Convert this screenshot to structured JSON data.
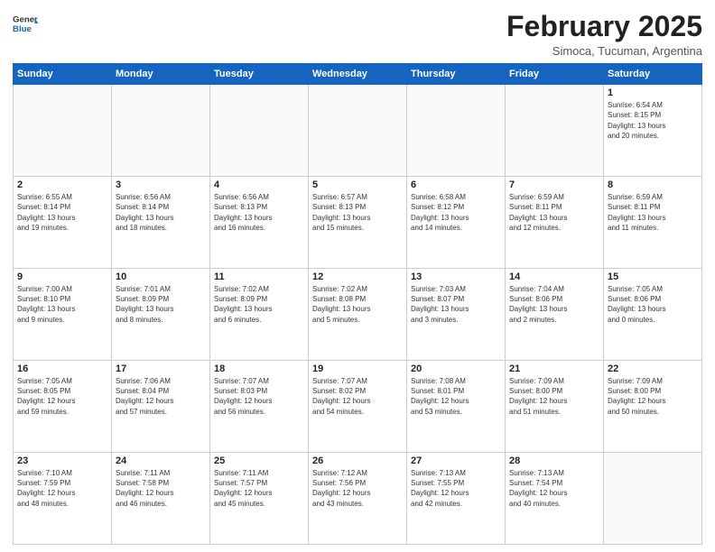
{
  "header": {
    "logo_line1": "General",
    "logo_line2": "Blue",
    "month_title": "February 2025",
    "location": "Simoca, Tucuman, Argentina"
  },
  "weekdays": [
    "Sunday",
    "Monday",
    "Tuesday",
    "Wednesday",
    "Thursday",
    "Friday",
    "Saturday"
  ],
  "weeks": [
    [
      {
        "day": "",
        "info": ""
      },
      {
        "day": "",
        "info": ""
      },
      {
        "day": "",
        "info": ""
      },
      {
        "day": "",
        "info": ""
      },
      {
        "day": "",
        "info": ""
      },
      {
        "day": "",
        "info": ""
      },
      {
        "day": "1",
        "info": "Sunrise: 6:54 AM\nSunset: 8:15 PM\nDaylight: 13 hours\nand 20 minutes."
      }
    ],
    [
      {
        "day": "2",
        "info": "Sunrise: 6:55 AM\nSunset: 8:14 PM\nDaylight: 13 hours\nand 19 minutes."
      },
      {
        "day": "3",
        "info": "Sunrise: 6:56 AM\nSunset: 8:14 PM\nDaylight: 13 hours\nand 18 minutes."
      },
      {
        "day": "4",
        "info": "Sunrise: 6:56 AM\nSunset: 8:13 PM\nDaylight: 13 hours\nand 16 minutes."
      },
      {
        "day": "5",
        "info": "Sunrise: 6:57 AM\nSunset: 8:13 PM\nDaylight: 13 hours\nand 15 minutes."
      },
      {
        "day": "6",
        "info": "Sunrise: 6:58 AM\nSunset: 8:12 PM\nDaylight: 13 hours\nand 14 minutes."
      },
      {
        "day": "7",
        "info": "Sunrise: 6:59 AM\nSunset: 8:11 PM\nDaylight: 13 hours\nand 12 minutes."
      },
      {
        "day": "8",
        "info": "Sunrise: 6:59 AM\nSunset: 8:11 PM\nDaylight: 13 hours\nand 11 minutes."
      }
    ],
    [
      {
        "day": "9",
        "info": "Sunrise: 7:00 AM\nSunset: 8:10 PM\nDaylight: 13 hours\nand 9 minutes."
      },
      {
        "day": "10",
        "info": "Sunrise: 7:01 AM\nSunset: 8:09 PM\nDaylight: 13 hours\nand 8 minutes."
      },
      {
        "day": "11",
        "info": "Sunrise: 7:02 AM\nSunset: 8:09 PM\nDaylight: 13 hours\nand 6 minutes."
      },
      {
        "day": "12",
        "info": "Sunrise: 7:02 AM\nSunset: 8:08 PM\nDaylight: 13 hours\nand 5 minutes."
      },
      {
        "day": "13",
        "info": "Sunrise: 7:03 AM\nSunset: 8:07 PM\nDaylight: 13 hours\nand 3 minutes."
      },
      {
        "day": "14",
        "info": "Sunrise: 7:04 AM\nSunset: 8:06 PM\nDaylight: 13 hours\nand 2 minutes."
      },
      {
        "day": "15",
        "info": "Sunrise: 7:05 AM\nSunset: 8:06 PM\nDaylight: 13 hours\nand 0 minutes."
      }
    ],
    [
      {
        "day": "16",
        "info": "Sunrise: 7:05 AM\nSunset: 8:05 PM\nDaylight: 12 hours\nand 59 minutes."
      },
      {
        "day": "17",
        "info": "Sunrise: 7:06 AM\nSunset: 8:04 PM\nDaylight: 12 hours\nand 57 minutes."
      },
      {
        "day": "18",
        "info": "Sunrise: 7:07 AM\nSunset: 8:03 PM\nDaylight: 12 hours\nand 56 minutes."
      },
      {
        "day": "19",
        "info": "Sunrise: 7:07 AM\nSunset: 8:02 PM\nDaylight: 12 hours\nand 54 minutes."
      },
      {
        "day": "20",
        "info": "Sunrise: 7:08 AM\nSunset: 8:01 PM\nDaylight: 12 hours\nand 53 minutes."
      },
      {
        "day": "21",
        "info": "Sunrise: 7:09 AM\nSunset: 8:00 PM\nDaylight: 12 hours\nand 51 minutes."
      },
      {
        "day": "22",
        "info": "Sunrise: 7:09 AM\nSunset: 8:00 PM\nDaylight: 12 hours\nand 50 minutes."
      }
    ],
    [
      {
        "day": "23",
        "info": "Sunrise: 7:10 AM\nSunset: 7:59 PM\nDaylight: 12 hours\nand 48 minutes."
      },
      {
        "day": "24",
        "info": "Sunrise: 7:11 AM\nSunset: 7:58 PM\nDaylight: 12 hours\nand 46 minutes."
      },
      {
        "day": "25",
        "info": "Sunrise: 7:11 AM\nSunset: 7:57 PM\nDaylight: 12 hours\nand 45 minutes."
      },
      {
        "day": "26",
        "info": "Sunrise: 7:12 AM\nSunset: 7:56 PM\nDaylight: 12 hours\nand 43 minutes."
      },
      {
        "day": "27",
        "info": "Sunrise: 7:13 AM\nSunset: 7:55 PM\nDaylight: 12 hours\nand 42 minutes."
      },
      {
        "day": "28",
        "info": "Sunrise: 7:13 AM\nSunset: 7:54 PM\nDaylight: 12 hours\nand 40 minutes."
      },
      {
        "day": "",
        "info": ""
      }
    ]
  ]
}
